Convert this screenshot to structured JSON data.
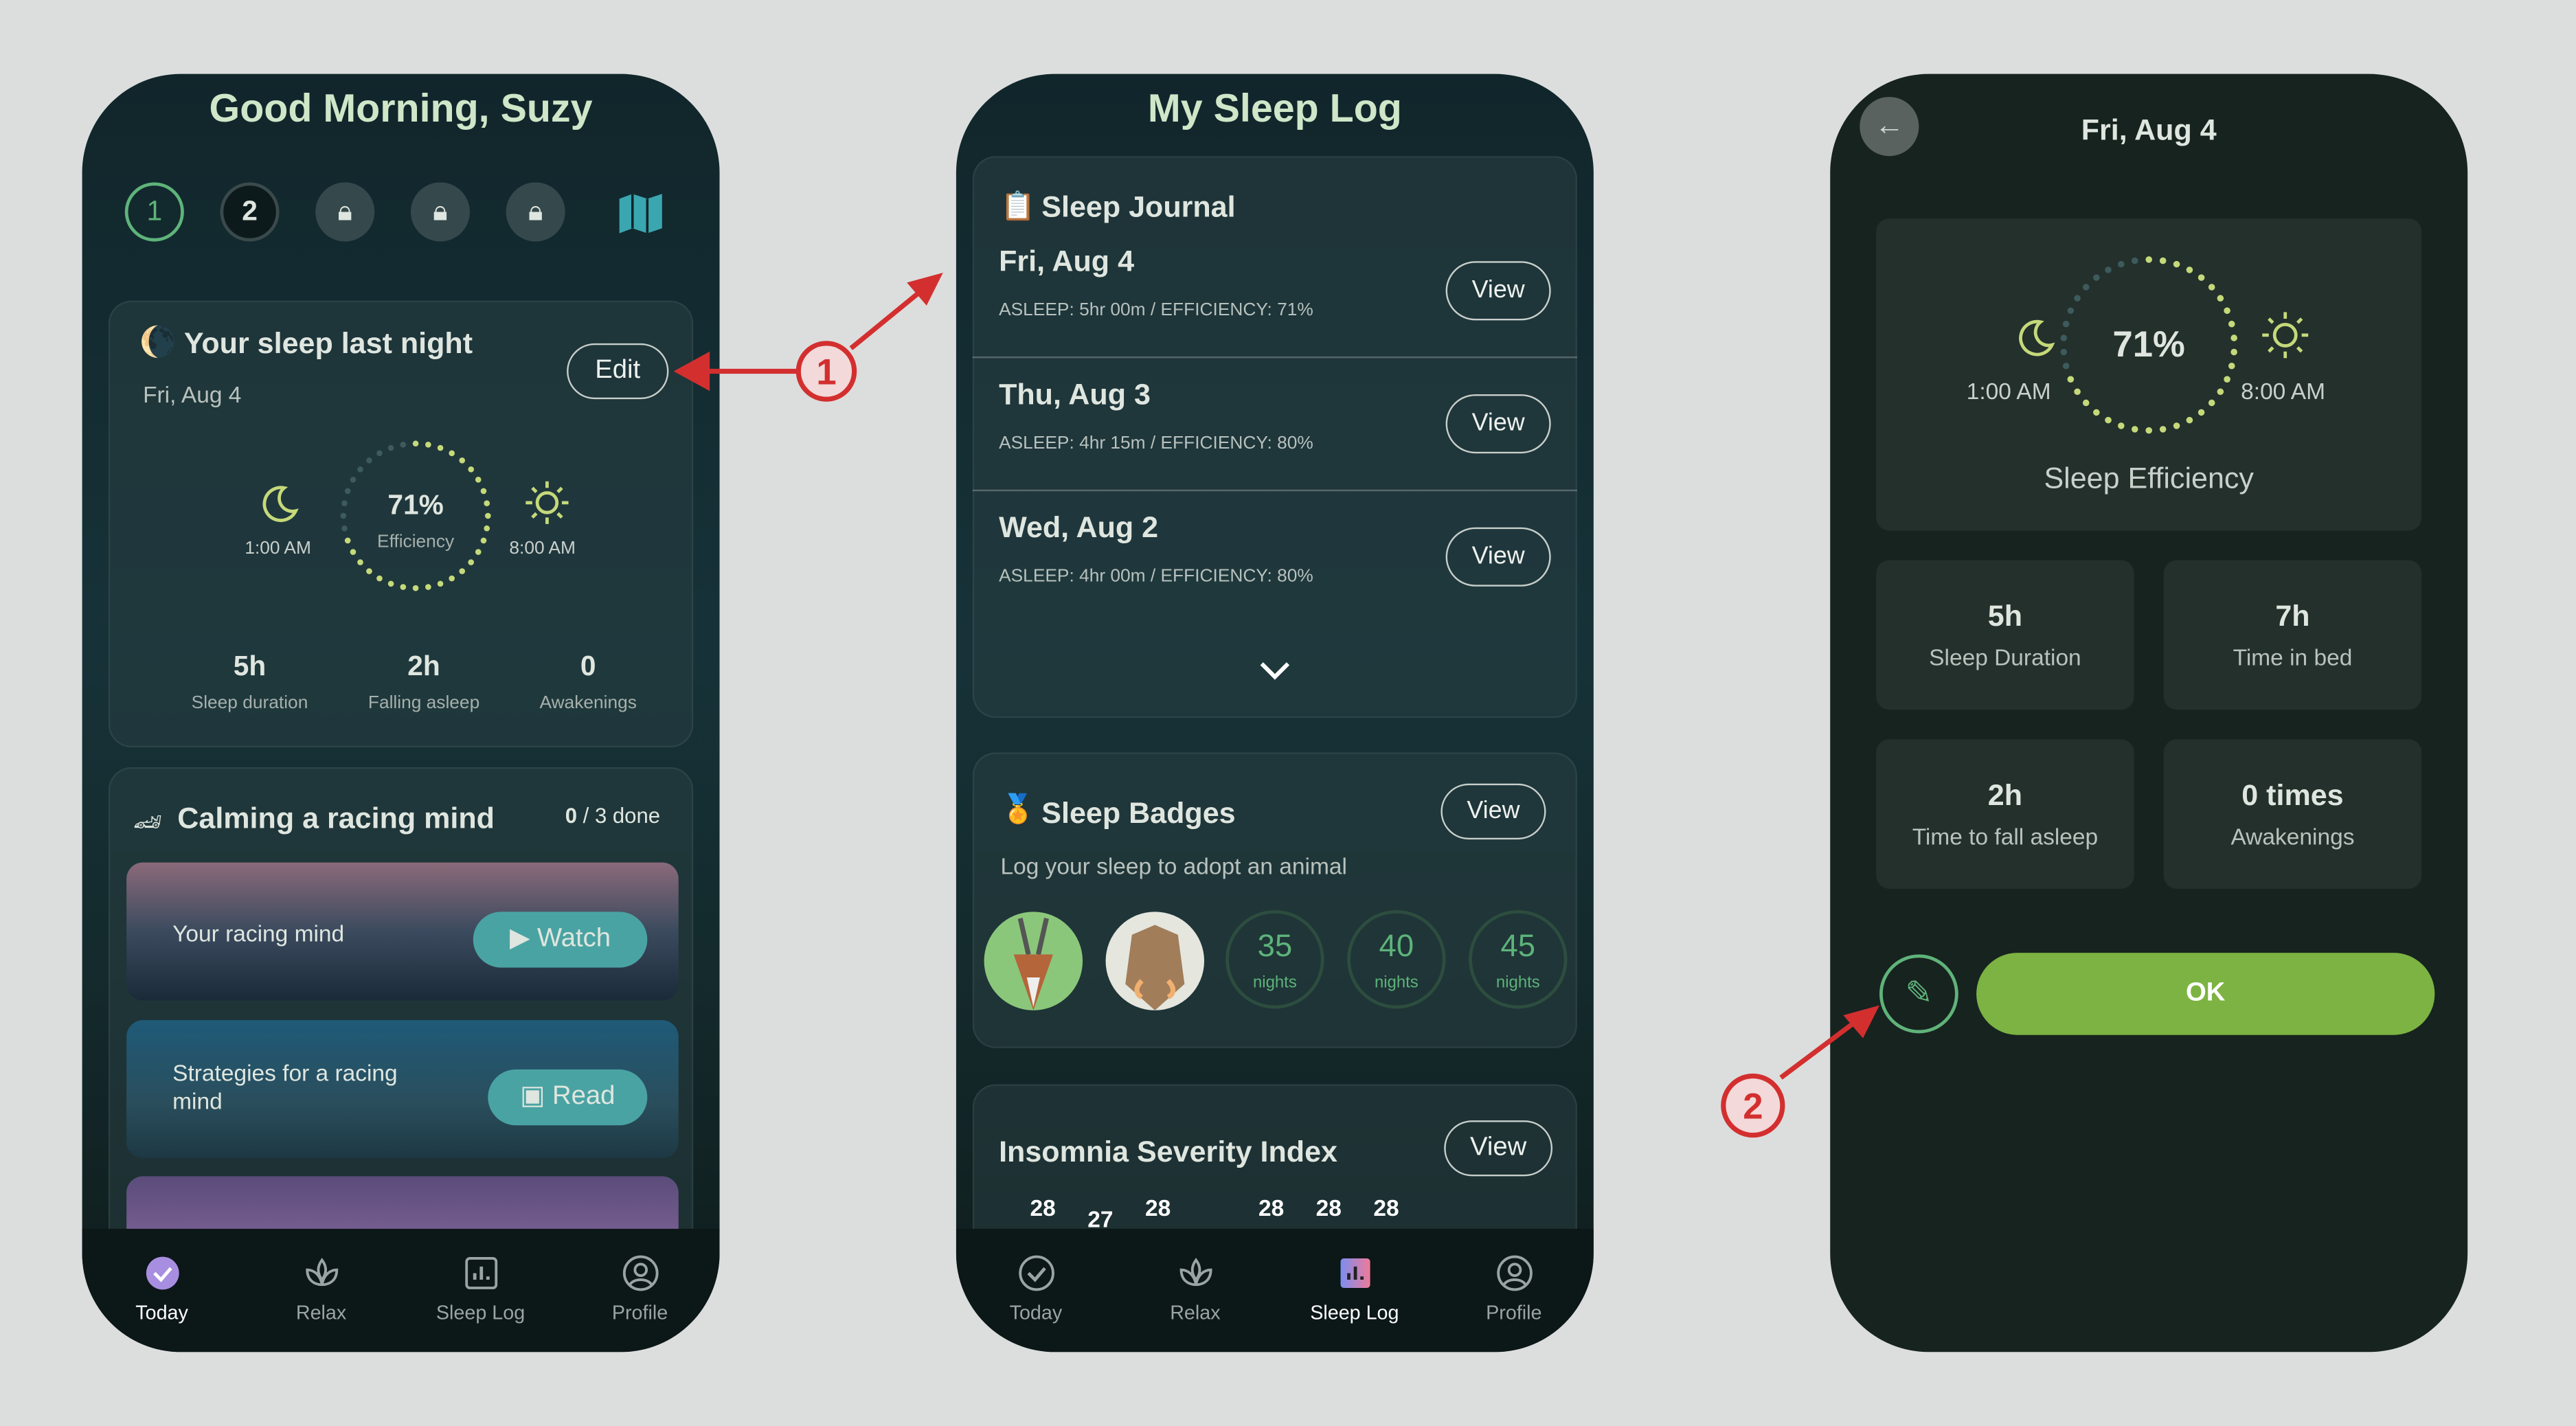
{
  "colors": {
    "accent_green": "#7cb342",
    "dot_green": "#c5d97a",
    "annotation_red": "#d32f2f",
    "teal": "#4aa3a3"
  },
  "today": {
    "greeting": "Good Morning, Suzy",
    "steps": [
      "1",
      "2"
    ],
    "sleep_card": {
      "title": "Your sleep last night",
      "date": "Fri, Aug 4",
      "edit": "Edit",
      "bed_time": "1:00 AM",
      "wake_time": "8:00 AM",
      "efficiency": "71%",
      "efficiency_label": "Efficiency",
      "efficiency_value": 71,
      "stats": [
        {
          "v": "5h",
          "l": "Sleep duration"
        },
        {
          "v": "2h",
          "l": "Falling asleep"
        },
        {
          "v": "0",
          "l": "Awakenings"
        }
      ]
    },
    "course": {
      "title": "Calming a racing mind",
      "done": "0",
      "total": "/ 3 done",
      "items": [
        {
          "title": "Your racing mind",
          "action": "Watch"
        },
        {
          "title": "Strategies for a racing mind",
          "action": "Read"
        }
      ]
    }
  },
  "nav": [
    {
      "label": "Today",
      "icon": "check-circle-icon"
    },
    {
      "label": "Relax",
      "icon": "lotus-icon"
    },
    {
      "label": "Sleep Log",
      "icon": "bar-chart-icon"
    },
    {
      "label": "Profile",
      "icon": "profile-icon"
    }
  ],
  "log": {
    "title": "My Sleep Log",
    "journal_title": "Sleep Journal",
    "entries": [
      {
        "date": "Fri, Aug 4",
        "summary": "ASLEEP: 5hr 00m / EFFICIENCY: 71%",
        "action": "View"
      },
      {
        "date": "Thu, Aug 3",
        "summary": "ASLEEP: 4hr 15m / EFFICIENCY: 80%",
        "action": "View"
      },
      {
        "date": "Wed, Aug 2",
        "summary": "ASLEEP: 4hr 00m / EFFICIENCY: 80%",
        "action": "View"
      }
    ],
    "badges": {
      "title": "Sleep Badges",
      "action": "View",
      "subtitle": "Log your sleep to adopt an animal",
      "locked": [
        {
          "n": "35",
          "u": "nights"
        },
        {
          "n": "40",
          "u": "nights"
        },
        {
          "n": "45",
          "u": "nights"
        }
      ]
    },
    "isi": {
      "title": "Insomnia Severity Index",
      "action": "View",
      "values": [
        "28",
        "27",
        "28",
        "28",
        "28",
        "28"
      ]
    }
  },
  "detail": {
    "title": "Fri, Aug 4",
    "bed_time": "1:00 AM",
    "wake_time": "8:00 AM",
    "efficiency": "71%",
    "efficiency_label": "Sleep Efficiency",
    "tiles": [
      {
        "v": "5h",
        "l": "Sleep Duration"
      },
      {
        "v": "7h",
        "l": "Time in bed"
      },
      {
        "v": "2h",
        "l": "Time to fall asleep"
      },
      {
        "v": "0 times",
        "l": "Awakenings"
      }
    ],
    "ok": "OK"
  },
  "annotations": [
    "1",
    "2"
  ]
}
